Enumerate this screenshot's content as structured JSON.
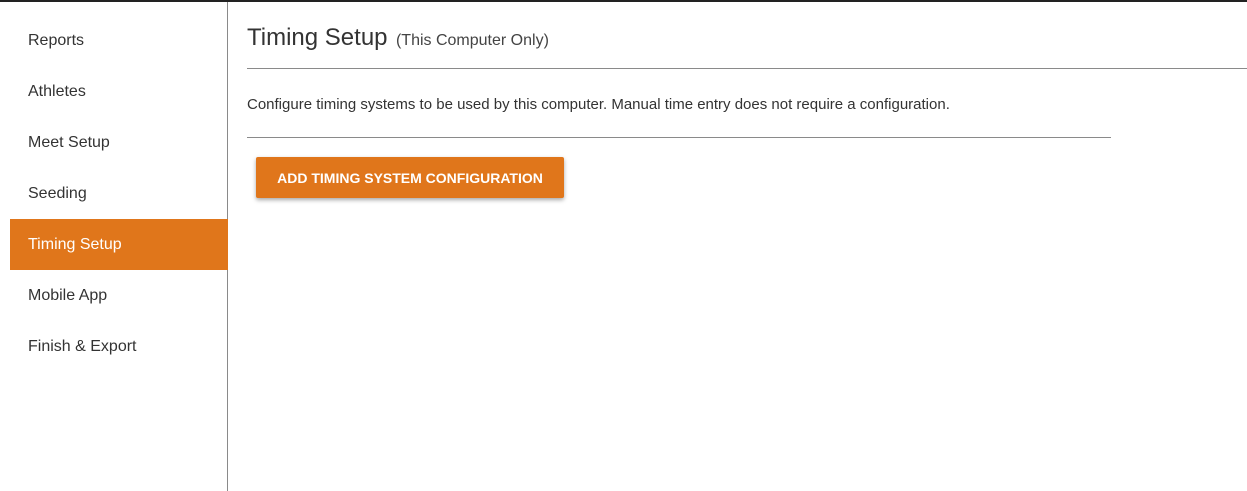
{
  "sidebar": {
    "items": [
      {
        "label": "Reports",
        "active": false
      },
      {
        "label": "Athletes",
        "active": false
      },
      {
        "label": "Meet Setup",
        "active": false
      },
      {
        "label": "Seeding",
        "active": false
      },
      {
        "label": "Timing Setup",
        "active": true
      },
      {
        "label": "Mobile App",
        "active": false
      },
      {
        "label": "Finish & Export",
        "active": false
      }
    ]
  },
  "main": {
    "title": "Timing Setup",
    "subtitle": "(This Computer Only)",
    "description": "Configure timing systems to be used by this computer. Manual time entry does not require a configuration.",
    "add_button_label": "ADD TIMING SYSTEM CONFIGURATION"
  },
  "colors": {
    "accent": "#e0761b",
    "text": "#333333",
    "divider": "#8a8a8a"
  }
}
